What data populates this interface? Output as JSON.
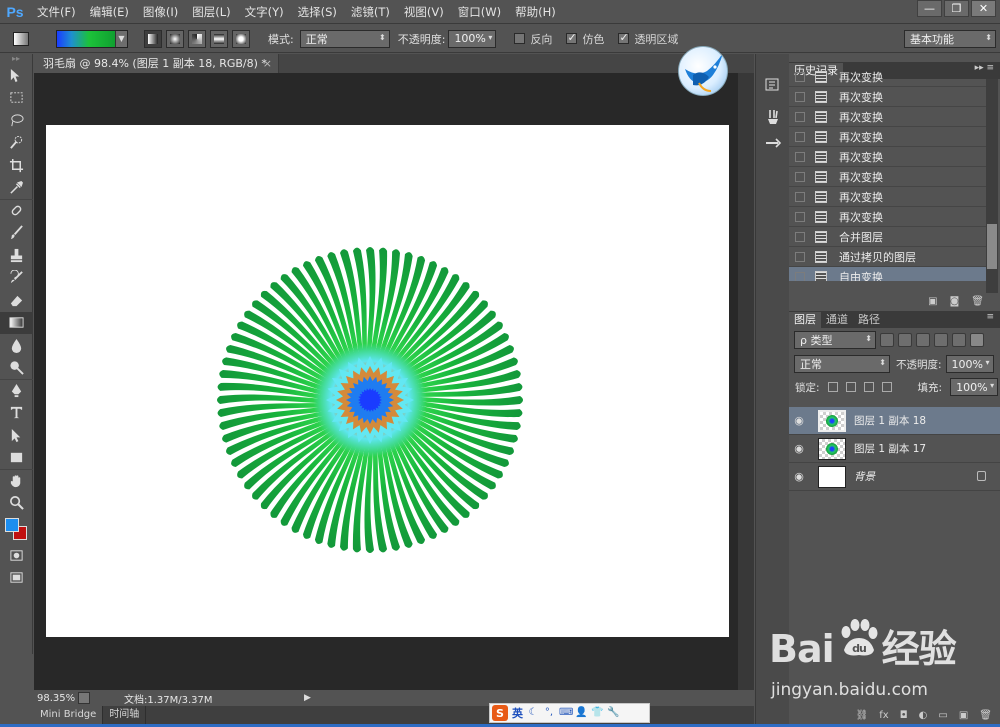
{
  "app": {
    "logo": "Ps"
  },
  "menu": [
    "文件(F)",
    "编辑(E)",
    "图像(I)",
    "图层(L)",
    "文字(Y)",
    "选择(S)",
    "滤镜(T)",
    "视图(V)",
    "窗口(W)",
    "帮助(H)"
  ],
  "window_controls": {
    "minimize": "—",
    "restore": "❐",
    "close": "✕"
  },
  "options": {
    "mode_label": "模式:",
    "mode_value": "正常",
    "opacity_label": "不透明度:",
    "opacity_value": "100%",
    "reverse_label": "反向",
    "reverse_checked": false,
    "dither_label": "仿色",
    "dither_checked": true,
    "transparency_label": "透明区域",
    "transparency_checked": true,
    "workspace": "基本功能"
  },
  "document": {
    "tab_title": "羽毛扇 @ 98.4% (图层 1 副本 18, RGB/8) *",
    "tab_close": "×"
  },
  "status": {
    "zoom": "98.35%",
    "doc_info": "文档:1.37M/3.37M",
    "arrow": "▶"
  },
  "bottom_tabs": [
    "Mini Bridge",
    "时间轴"
  ],
  "history": {
    "tab": "历史记录",
    "items": [
      {
        "label": "再次变换",
        "selected": false
      },
      {
        "label": "再次变换",
        "selected": false
      },
      {
        "label": "再次变换",
        "selected": false
      },
      {
        "label": "再次变换",
        "selected": false
      },
      {
        "label": "再次变换",
        "selected": false
      },
      {
        "label": "再次变换",
        "selected": false
      },
      {
        "label": "再次变换",
        "selected": false
      },
      {
        "label": "再次变换",
        "selected": false
      },
      {
        "label": "合并图层",
        "selected": false
      },
      {
        "label": "通过拷贝的图层",
        "selected": false
      },
      {
        "label": "自由变换",
        "selected": true
      }
    ]
  },
  "layers_panel": {
    "tabs": [
      "图层",
      "通道",
      "路径"
    ],
    "filter_label": "ρ 类型",
    "blend_mode": "正常",
    "opacity_label": "不透明度:",
    "opacity_value": "100%",
    "lock_label": "锁定:",
    "fill_label": "填充:",
    "fill_value": "100%",
    "layers": [
      {
        "name": "图层 1 副本 18",
        "selected": true,
        "locked": false,
        "thumb": "flower"
      },
      {
        "name": "图层 1 副本 17",
        "selected": false,
        "locked": false,
        "thumb": "flower"
      },
      {
        "name": "背景",
        "selected": false,
        "locked": true,
        "thumb": "white"
      }
    ]
  },
  "colors": {
    "foreground": "#1c8ef0",
    "background": "#c01010",
    "selection": "#6c7a8c"
  },
  "ime": {
    "logo": "S",
    "lang": "英"
  },
  "watermark": {
    "brand_left": "Bai",
    "brand_right": "经验",
    "url": "jingyan.baidu.com"
  }
}
